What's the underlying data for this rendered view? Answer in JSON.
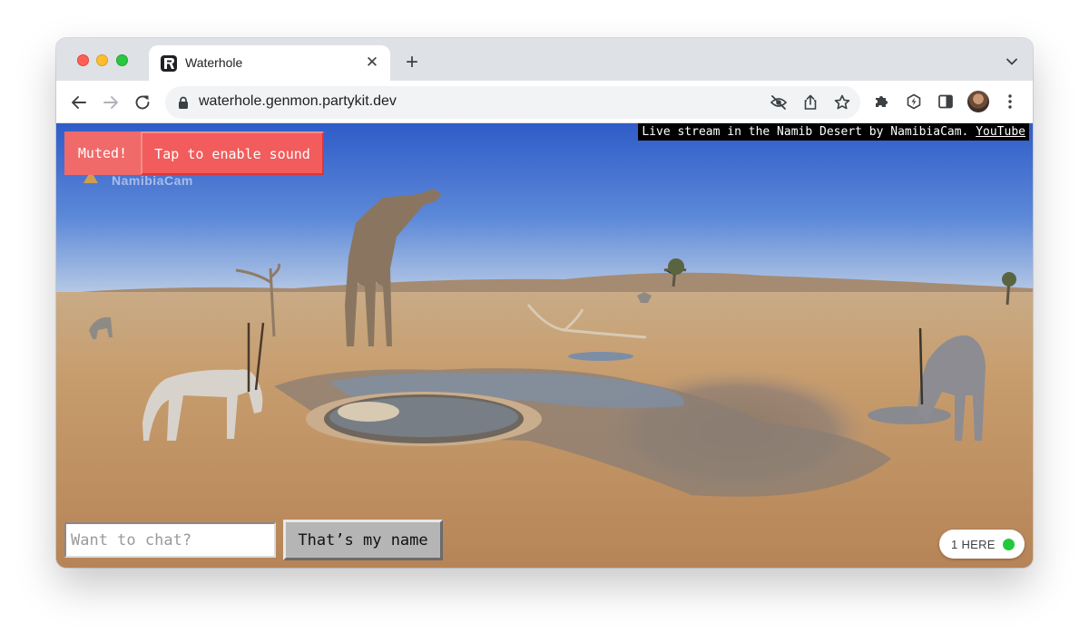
{
  "browser": {
    "tab": {
      "title": "Waterhole",
      "favicon": "partykit-logo-icon",
      "close_icon": "close-icon"
    },
    "new_tab_label": "+",
    "url": "waterhole.genmon.partykit.dev",
    "toolbar_icons": [
      "back-arrow-icon",
      "forward-arrow-icon",
      "reload-icon",
      "lock-icon",
      "eye-slash-icon",
      "share-icon",
      "star-icon",
      "puzzle-extension-icon",
      "lightning-extension-icon",
      "side-panel-icon",
      "avatar",
      "kebab-menu-icon"
    ]
  },
  "stream": {
    "credit_text": "Live stream in the Namib Desert by NamibiaCam.",
    "credit_link": "YouTube",
    "watermark": "NamibiaCam"
  },
  "sound": {
    "muted_label": "Muted!",
    "enable_label": "Tap to enable sound"
  },
  "chat": {
    "placeholder": "Want to chat?",
    "value": "",
    "name_button_label": "That’s my name"
  },
  "presence": {
    "label": "1 HERE",
    "status_color": "#22c93f"
  },
  "colors": {
    "muted_bg": "#f06a6a",
    "enable_bg": "#f25c5c",
    "name_button_bg": "#b5b5b5"
  }
}
